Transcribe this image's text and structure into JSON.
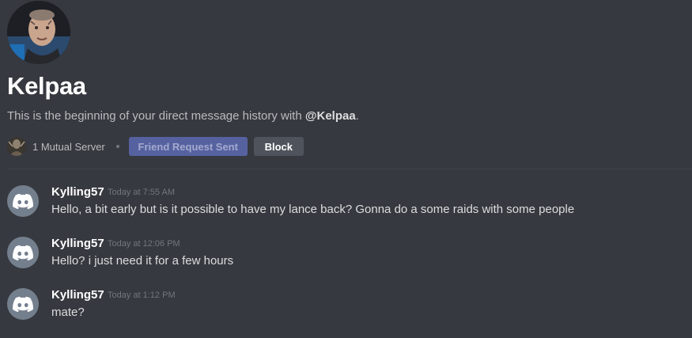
{
  "profile": {
    "username": "Kelpaa",
    "intro_prefix": "This is the beginning of your direct message history with ",
    "intro_mention": "@Kelpaa",
    "intro_suffix": ".",
    "mutual_servers": "1 Mutual Server",
    "friend_request_label": "Friend Request Sent",
    "block_label": "Block",
    "avatar_icon": "user-photo",
    "server_icon": "server-photo"
  },
  "colors": {
    "background": "#36393f",
    "friend_button": "#5865a6",
    "block_button": "#4f545c",
    "default_avatar": "#747f8d"
  },
  "messages": [
    {
      "author": "Kylling57",
      "timestamp": "Today at 7:55 AM",
      "text": "Hello, a bit early but is it possible to have my lance back? Gonna do a some raids with some people",
      "avatar_icon": "discord-default-avatar"
    },
    {
      "author": "Kylling57",
      "timestamp": "Today at 12:06 PM",
      "text": "Hello? i just need it for a few hours",
      "avatar_icon": "discord-default-avatar"
    },
    {
      "author": "Kylling57",
      "timestamp": "Today at 1:12 PM",
      "text": "mate?",
      "avatar_icon": "discord-default-avatar"
    }
  ]
}
